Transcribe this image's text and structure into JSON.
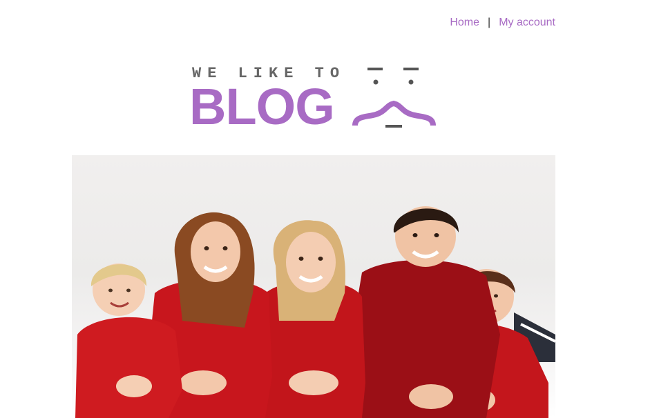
{
  "nav": {
    "home_label": "Home",
    "separator": "|",
    "account_label": "My account"
  },
  "logo": {
    "tagline": "WE LIKE TO",
    "brand": "BLOG",
    "brand_color": "#a86bc4",
    "tagline_color": "#666666",
    "icon": "face-icon"
  },
  "hero": {
    "subject": "family-photo",
    "accent_color": "#c4161c"
  }
}
